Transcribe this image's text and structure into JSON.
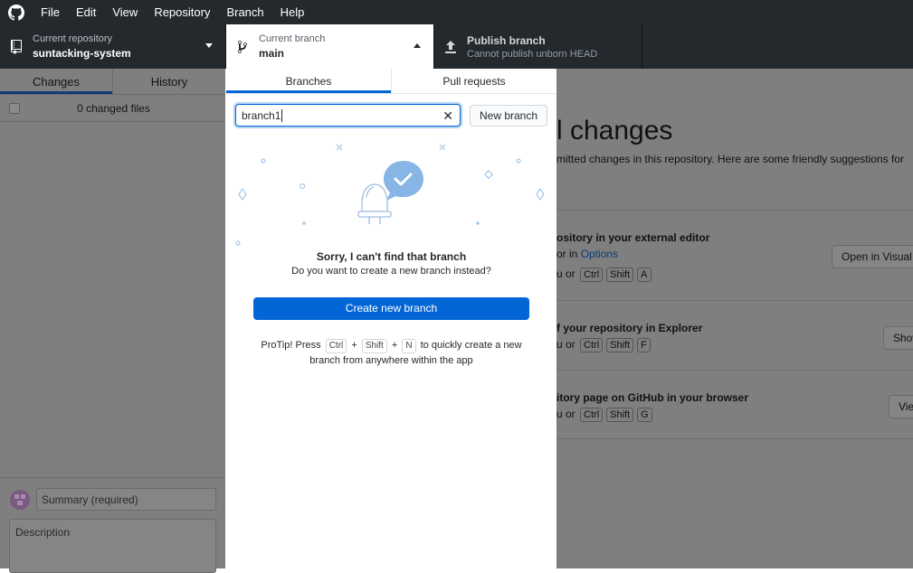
{
  "menubar": {
    "items": [
      "File",
      "Edit",
      "View",
      "Repository",
      "Branch",
      "Help"
    ]
  },
  "toolbar": {
    "repo": {
      "label": "Current repository",
      "value": "suntacking-system"
    },
    "branch": {
      "label": "Current branch",
      "value": "main"
    },
    "publish": {
      "label": "Publish branch",
      "sub": "Cannot publish unborn HEAD"
    }
  },
  "left": {
    "tabs": [
      "Changes",
      "History"
    ],
    "changed_files": "0 changed files",
    "summary_placeholder": "Summary (required)",
    "description_placeholder": "Description"
  },
  "right": {
    "heading": "l changes",
    "subtext": "mitted changes in this repository. Here are some friendly suggestions for",
    "sections": [
      {
        "title": "ository in your external editor",
        "line_pre": "or in ",
        "line_link": "Options",
        "line2_pre": "u or",
        "keys": [
          "Ctrl",
          "Shift",
          "A"
        ],
        "button": "Open in Visual"
      },
      {
        "title": "f your repository in Explorer",
        "line2_pre": "u or",
        "keys": [
          "Ctrl",
          "Shift",
          "F"
        ],
        "button": "Show"
      },
      {
        "title": "itory page on GitHub in your browser",
        "line2_pre": "u or",
        "keys": [
          "Ctrl",
          "Shift",
          "G"
        ],
        "button": "View"
      }
    ]
  },
  "popup": {
    "tabs": [
      "Branches",
      "Pull requests"
    ],
    "search_value": "branch1",
    "new_branch": "New branch",
    "sorry": "Sorry, I can't find that branch",
    "question": "Do you want to create a new branch instead?",
    "create_button": "Create new branch",
    "protip_pre": "ProTip! Press",
    "protip_keys": [
      "Ctrl",
      "Shift",
      "N"
    ],
    "protip_plus": "+",
    "protip_post": "to quickly create a new",
    "protip_line2": "branch from anywhere within the app"
  },
  "colors": {
    "accent": "#0366d6",
    "dark": "#24292e"
  },
  "icons": [
    "github-logo-icon",
    "repo-icon",
    "branch-icon",
    "publish-icon",
    "caret-down-icon",
    "caret-up-icon",
    "clear-icon",
    "bell-bubble-icon",
    "avatar-icon"
  ]
}
